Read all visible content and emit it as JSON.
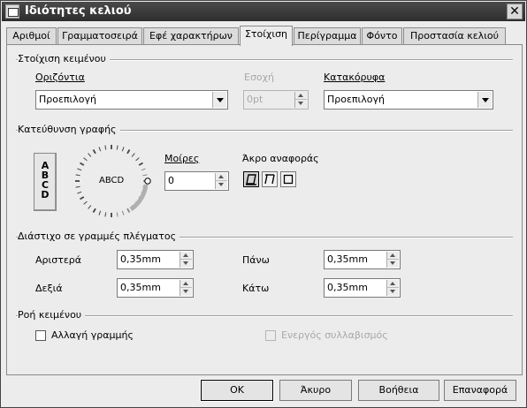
{
  "window": {
    "title": "Ιδιότητες κελιού",
    "close_glyph": "✕"
  },
  "tabs": [
    {
      "label": "Αριθμοί"
    },
    {
      "label": "Γραμματοσειρά"
    },
    {
      "label": "Εφέ χαρακτήρων"
    },
    {
      "label": "Στοίχιση",
      "active": true
    },
    {
      "label": "Περίγραμμα"
    },
    {
      "label": "Φόντο"
    },
    {
      "label": "Προστασία κελιού"
    }
  ],
  "alignment": {
    "section_title": "Στοίχιση κειμένου",
    "horizontal_label": "Οριζόντια",
    "horizontal_value": "Προεπιλογή",
    "indent_label": "Εσοχή",
    "indent_value": "0pt",
    "vertical_label": "Κατακόρυφα",
    "vertical_value": "Προεπιλογή"
  },
  "direction": {
    "section_title": "Κατεύθυνση γραφής",
    "stacked_letters": [
      "A",
      "B",
      "C",
      "D"
    ],
    "dial_text": "ABCD",
    "degrees_label": "Μοίρες",
    "degrees_value": "0",
    "refedge_label": "Άκρο αναφοράς",
    "refedge_icons": [
      "bottom-edge-icon",
      "top-edge-icon",
      "cell-inside-icon"
    ]
  },
  "spacing": {
    "section_title": "Διάστιχο σε γραμμές πλέγματος",
    "left_label": "Αριστερά",
    "left_value": "0,35mm",
    "right_label": "Δεξιά",
    "right_value": "0,35mm",
    "top_label": "Πάνω",
    "top_value": "0,35mm",
    "bottom_label": "Κάτω",
    "bottom_value": "0,35mm"
  },
  "textflow": {
    "section_title": "Ροή κειμένου",
    "wrap_label": "Αλλαγή γραμμής",
    "wrap_checked": false,
    "hyphen_label": "Ενεργός συλλαβισμός",
    "hyphen_checked": false
  },
  "buttons": {
    "ok": "OK",
    "cancel": "Άκυρο",
    "help": "Βοήθεια",
    "reset": "Επαναφορά"
  }
}
